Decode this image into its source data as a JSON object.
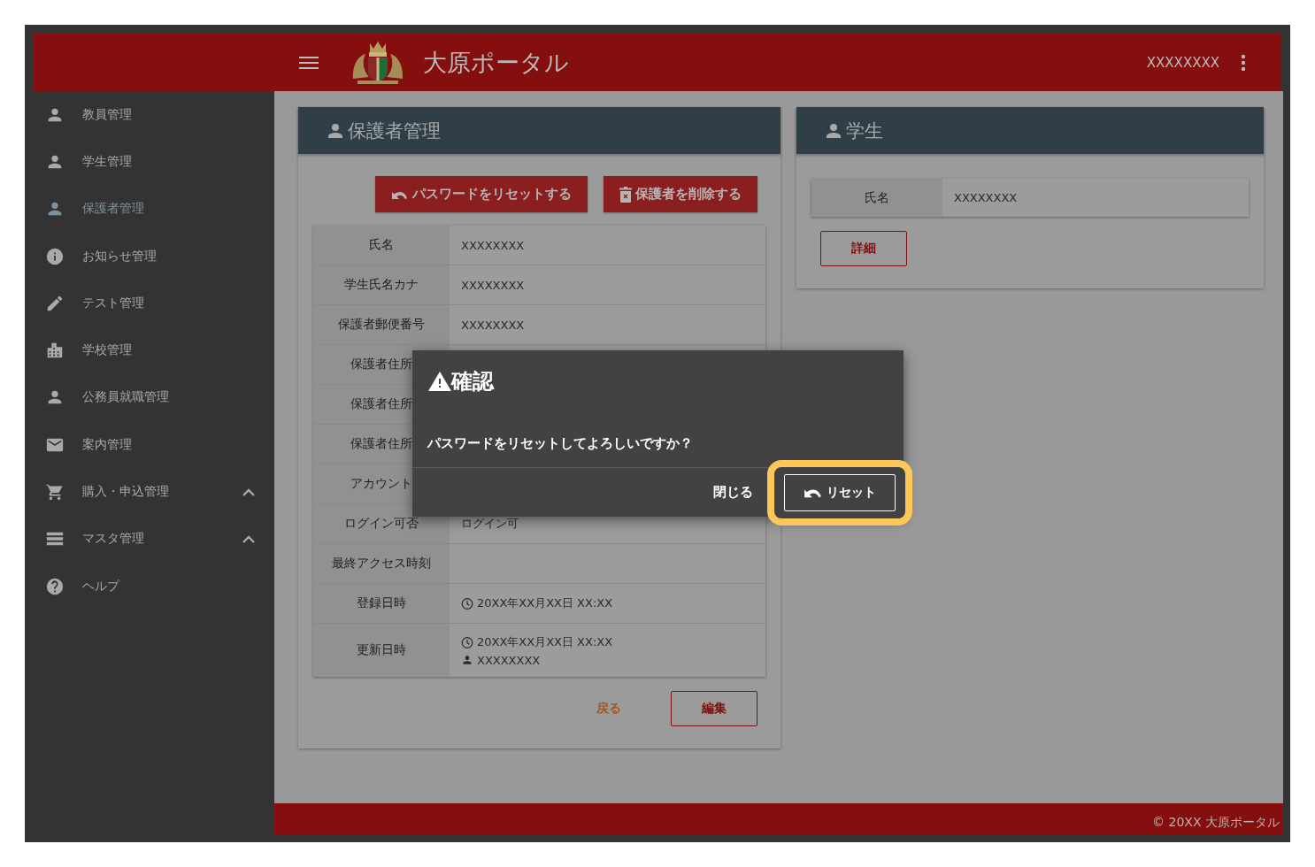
{
  "header": {
    "title": "大原ポータル",
    "user": "XXXXXXXX"
  },
  "sidebar": {
    "items": [
      {
        "label": "教員管理",
        "kind": "link",
        "selected": false
      },
      {
        "label": "学生管理",
        "kind": "link",
        "selected": false
      },
      {
        "label": "保護者管理",
        "kind": "link",
        "selected": true
      },
      {
        "label": "お知らせ管理",
        "kind": "link",
        "selected": false
      },
      {
        "label": "テスト管理",
        "kind": "link",
        "selected": false
      },
      {
        "label": "学校管理",
        "kind": "link",
        "selected": false
      },
      {
        "label": "公務員就職管理",
        "kind": "link",
        "selected": false
      },
      {
        "label": "案内管理",
        "kind": "link",
        "selected": false
      },
      {
        "label": "購入・申込管理",
        "kind": "group",
        "selected": false
      },
      {
        "label": "マスタ管理",
        "kind": "group",
        "selected": false
      },
      {
        "label": "ヘルプ",
        "kind": "link",
        "selected": false
      }
    ]
  },
  "guardian_panel": {
    "title": "保護者管理",
    "actions": [
      {
        "label": "パスワードをリセットする",
        "kind": "reset"
      },
      {
        "label": "保護者を削除する",
        "kind": "delete"
      }
    ],
    "rows": [
      {
        "label": "氏名",
        "values": [
          {
            "kind": "text",
            "text": "XXXXXXXX"
          }
        ]
      },
      {
        "label": "学生氏名カナ",
        "values": [
          {
            "kind": "text",
            "text": "XXXXXXXX"
          }
        ]
      },
      {
        "label": "保護者郵便番号",
        "values": [
          {
            "kind": "text",
            "text": "XXXXXXXX"
          }
        ]
      },
      {
        "label": "保護者住所"
      },
      {
        "label": "保護者住所"
      },
      {
        "label": "保護者住所"
      },
      {
        "label": "アカウント"
      },
      {
        "label": "ログイン可否",
        "values": [
          {
            "kind": "text",
            "text": "ログイン可"
          }
        ]
      },
      {
        "label": "最終アクセス時刻"
      },
      {
        "label": "登録日時",
        "values": [
          {
            "kind": "time",
            "text": "20XX年XX月XX日 XX:XX"
          }
        ]
      },
      {
        "label": "更新日時",
        "values": [
          {
            "kind": "time",
            "text": "20XX年XX月XX日 XX:XX"
          },
          {
            "kind": "user",
            "text": "XXXXXXXX"
          }
        ]
      }
    ],
    "buttons": [
      {
        "label": "戻る",
        "kind": "text"
      },
      {
        "label": "編集",
        "kind": "outlined"
      }
    ]
  },
  "student_panel": {
    "title": "学生",
    "rows": [
      {
        "label": "氏名",
        "value": "XXXXXXXX"
      }
    ],
    "button": "詳細"
  },
  "dialog": {
    "title": "確認",
    "message": "パスワードをリセットしてよろしいですか？",
    "buttons": [
      {
        "label": "閉じる",
        "kind": "text",
        "highlighted": false
      },
      {
        "label": "リセット",
        "kind": "outlined",
        "highlighted": true
      }
    ]
  },
  "footer": {
    "text": "© 20XX 大原ポータル"
  }
}
